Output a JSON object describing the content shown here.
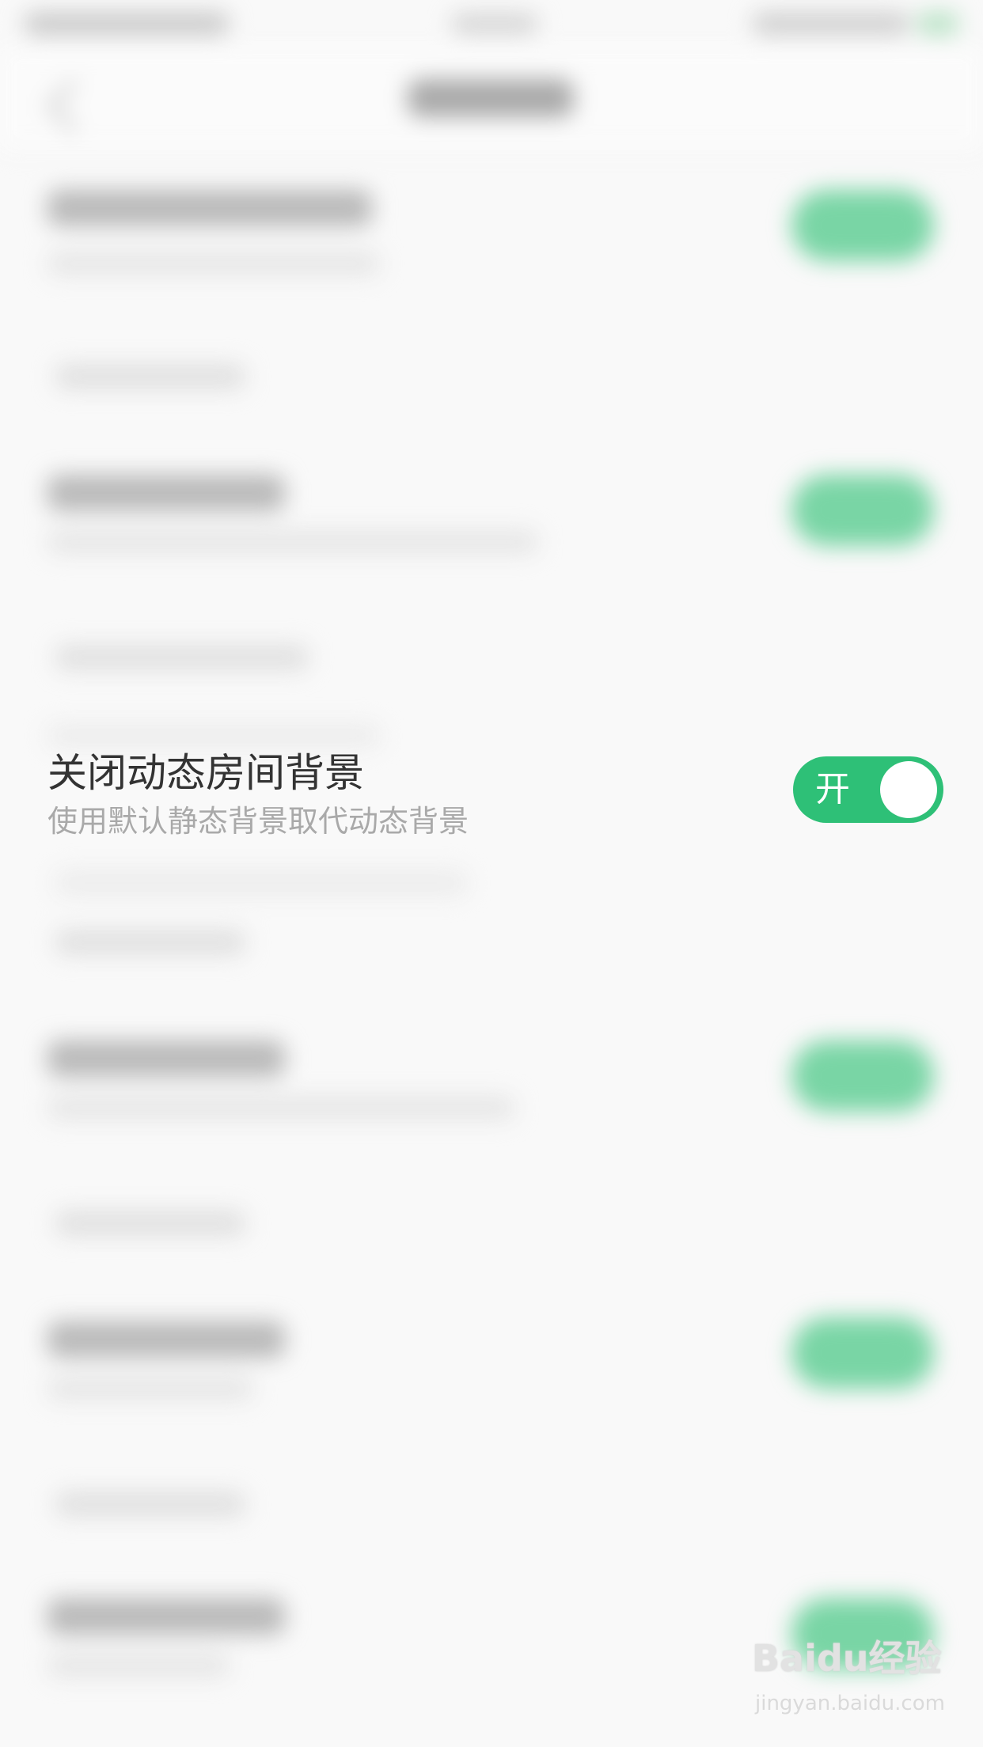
{
  "setting": {
    "title": "关闭动态房间背景",
    "subtitle": "使用默认静态背景取代动态背景",
    "toggle_label": "开",
    "toggle_on": true
  },
  "watermark": {
    "logo": "Baidu经验",
    "url": "jingyan.baidu.com"
  },
  "colors": {
    "toggle_on": "#2ec077",
    "title_text": "#333333",
    "subtitle_text": "#a9a9a9",
    "background": "#f9f9f9"
  }
}
